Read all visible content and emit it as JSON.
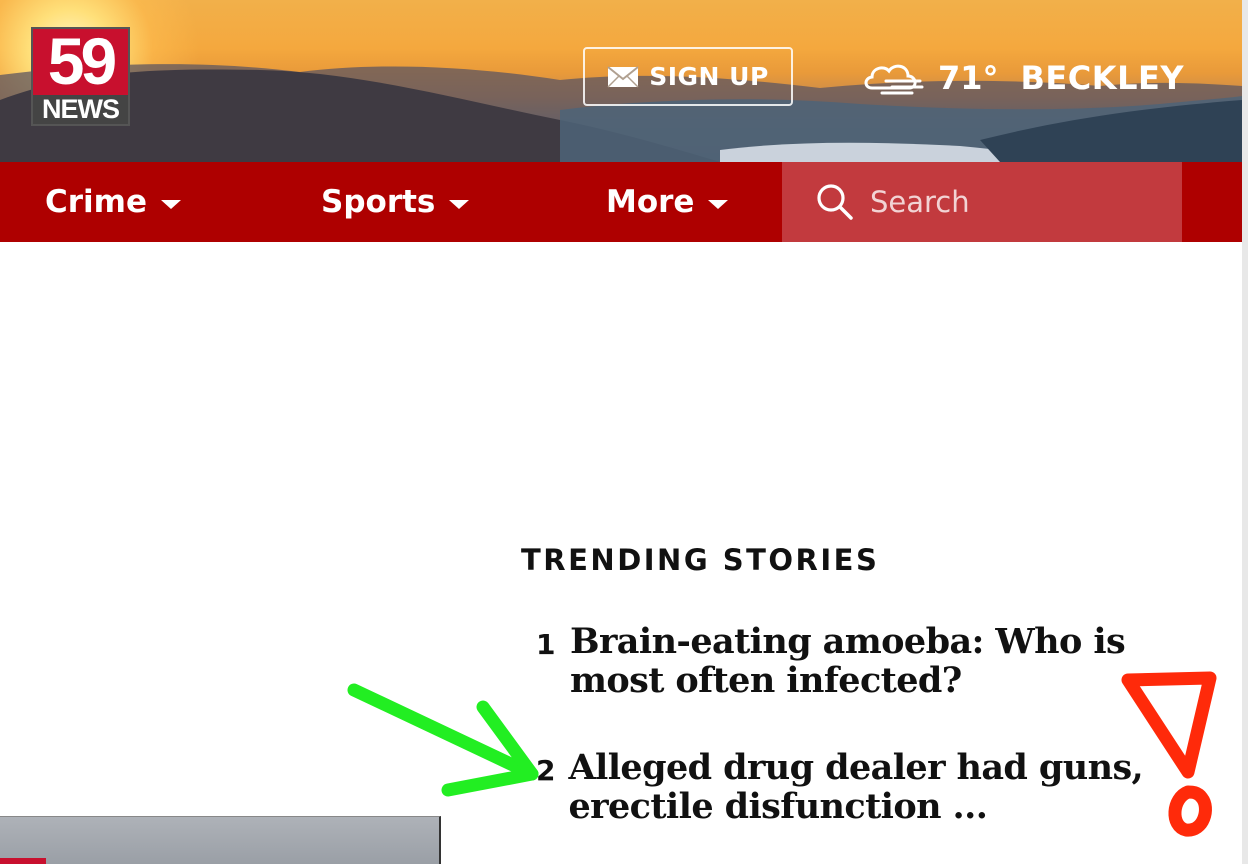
{
  "header": {
    "logo": {
      "number": "59",
      "word": "NEWS"
    },
    "signup_label": "SIGN UP",
    "weather": {
      "temp": "71°",
      "city": "BECKLEY"
    }
  },
  "nav": {
    "items": [
      {
        "label": "Crime"
      },
      {
        "label": "Sports"
      },
      {
        "label": "More"
      }
    ],
    "search_placeholder": "Search"
  },
  "trending": {
    "title": "TRENDING STORIES",
    "stories": [
      {
        "rank": "1",
        "headline": "Brain-eating amoeba: Who is most often infected?"
      },
      {
        "rank": "2",
        "headline": "Alleged drug dealer had guns, erectile disfunction ..."
      }
    ]
  },
  "annotations": {
    "arrow_color": "#22ee22",
    "exclamation_color": "#ff2a0a"
  },
  "colors": {
    "nav_red": "#ae0000",
    "search_red": "#c23a3e"
  }
}
